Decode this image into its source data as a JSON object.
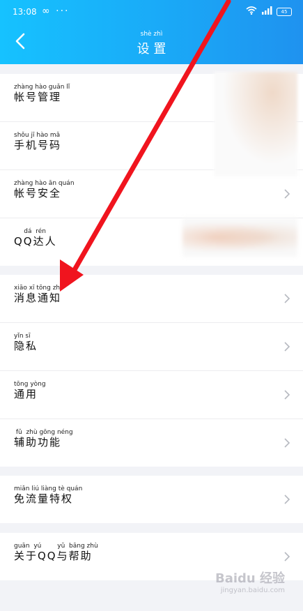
{
  "status": {
    "time": "13:08",
    "left_icons": "∞  ···",
    "battery": "45"
  },
  "header": {
    "title_pinyin": "shè  zhì",
    "title": "设 置"
  },
  "sections": [
    {
      "rows": [
        {
          "pinyin": "zhàng hào guǎn  lǐ",
          "label": "帐号管理"
        },
        {
          "pinyin": "shǒu  jī  hào  mǎ",
          "label": "手机号码"
        },
        {
          "pinyin": "zhàng hào  ān  quán",
          "label": "帐号安全"
        },
        {
          "pinyin": "     dá  rén",
          "label": "QQ达人"
        }
      ]
    },
    {
      "rows": [
        {
          "pinyin": "xiāo  xī  tōng  zhī",
          "label": "消息通知"
        },
        {
          "pinyin": "yǐn  sī",
          "label": "隐私"
        },
        {
          "pinyin": "tōng yòng",
          "label": "通用"
        },
        {
          "pinyin": " fǔ  zhù gōng néng",
          "label": "辅助功能"
        }
      ]
    },
    {
      "rows": [
        {
          "pinyin": "miǎn  liú liàng  tè  quán",
          "label": "免流量特权"
        }
      ]
    },
    {
      "rows": [
        {
          "pinyin": "guān  yú        yǔ  bāng zhù",
          "label": "关于QQ与帮助"
        }
      ]
    }
  ],
  "watermark": {
    "text": "Baidu 经验",
    "sub": "jingyan.baidu.com"
  },
  "colors": {
    "header": "#1aa9f7",
    "arrow": "#f0141e"
  }
}
